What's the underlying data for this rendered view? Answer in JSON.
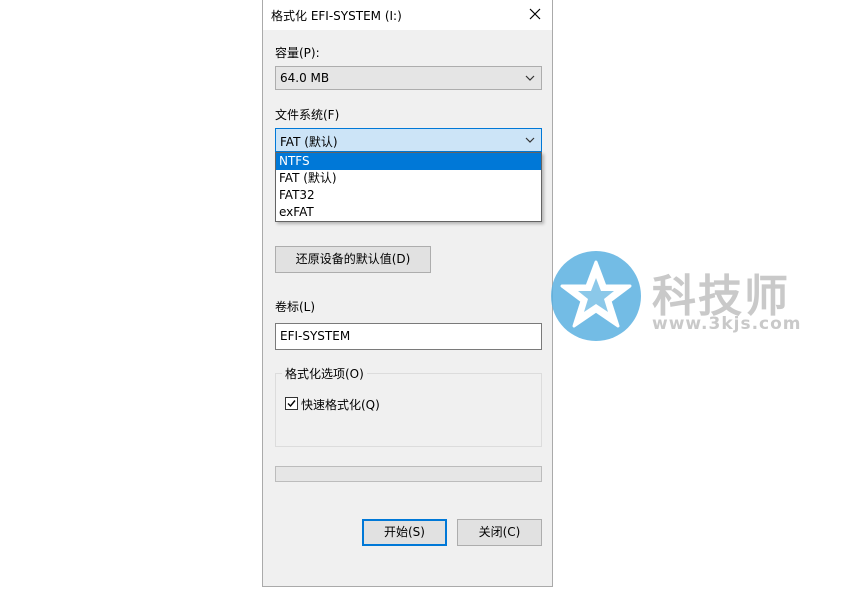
{
  "window": {
    "title": "格式化 EFI-SYSTEM (I:)"
  },
  "capacity": {
    "label": "容量(P):",
    "value": "64.0 MB"
  },
  "filesystem": {
    "label": "文件系统(F)",
    "value": "FAT (默认)",
    "options": [
      "NTFS",
      "FAT (默认)",
      "FAT32",
      "exFAT"
    ],
    "highlighted": "NTFS"
  },
  "restore_defaults_label": "还原设备的默认值(D)",
  "volume_label": {
    "label": "卷标(L)",
    "value": "EFI-SYSTEM"
  },
  "format_options": {
    "title": "格式化选项(O)",
    "quick_format_label": "快速格式化(Q)",
    "quick_format_checked": true
  },
  "progress": {
    "value": 0
  },
  "buttons": {
    "start": "开始(S)",
    "close": "关闭(C)"
  },
  "watermark": {
    "brand": "科技师",
    "url": "www.3kjs.com"
  },
  "colors": {
    "dialog_bg": "#f0f0f0",
    "accent": "#0078d7",
    "combo_focus_bg": "#cce4f7",
    "watermark": "#c9c9c9",
    "watermark_blue": "#5ab0e0"
  }
}
